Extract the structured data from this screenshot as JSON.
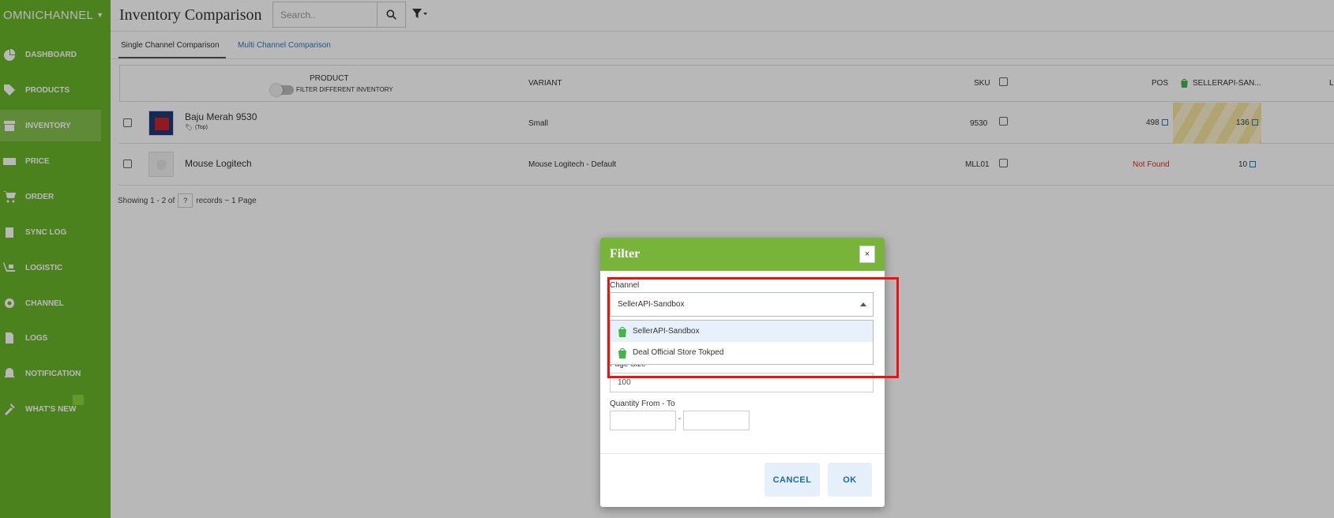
{
  "sidebar": {
    "brand": "OMNICHANNEL",
    "items": [
      {
        "label": "DASHBOARD",
        "icon": "dashboard-icon"
      },
      {
        "label": "PRODUCTS",
        "icon": "tag-icon"
      },
      {
        "label": "INVENTORY",
        "icon": "archive-icon"
      },
      {
        "label": "PRICE",
        "icon": "money-icon"
      },
      {
        "label": "ORDER",
        "icon": "cart-icon"
      },
      {
        "label": "SYNC LOG",
        "icon": "clipboard-icon"
      },
      {
        "label": "LOGISTIC",
        "icon": "dolly-icon"
      },
      {
        "label": "CHANNEL",
        "icon": "gear-icon"
      },
      {
        "label": "LOGS",
        "icon": "file-icon"
      },
      {
        "label": "NOTIFICATION",
        "icon": "bell-icon"
      },
      {
        "label": "WHAT'S NEW",
        "icon": "tools-icon"
      }
    ],
    "active": "INVENTORY"
  },
  "header": {
    "title": "Inventory Comparison",
    "search_placeholder": "Search.."
  },
  "tabs": [
    "Single Channel Comparison",
    "Multi Channel Comparison"
  ],
  "table": {
    "headers": {
      "product": "PRODUCT",
      "filter_toggle": "FILTER DIFFERENT INVENTORY",
      "variant": "VARIANT",
      "sku": "SKU",
      "pos": "POS",
      "channel": "SELLERAPI-SAN...",
      "extra": "L"
    },
    "rows": [
      {
        "name": "Baju Merah 9530",
        "tag": "(Top)",
        "variant": "Small",
        "sku": "9530",
        "pos": "498",
        "channel_qty": "136"
      },
      {
        "name": "Mouse Logitech",
        "tag": "",
        "variant": "Mouse Logitech - Default",
        "sku": "MLL01",
        "pos": "Not Found",
        "channel_qty": "10"
      }
    ]
  },
  "pager": {
    "prefix": "Showing 1 - 2 of",
    "count": "?",
    "suffix": "records ~ 1 Page"
  },
  "modal": {
    "title": "Filter",
    "close": "×",
    "channel_label": "Channel",
    "channel_value": "SellerAPI-Sandbox",
    "options": [
      "SellerAPI-Sandbox",
      "Deal Official Store Tokped"
    ],
    "page_size_label": "Page Size",
    "page_size_value": "100",
    "quantity_label": "Quantity From - To",
    "quantity_separator": "-",
    "cancel": "CANCEL",
    "ok": "OK"
  },
  "colors": {
    "sidebar": "#6ab42a",
    "modal_header": "#78b43a",
    "link": "#2a7ab8",
    "not_found": "#d9302c",
    "annotation": "#ee1111"
  }
}
